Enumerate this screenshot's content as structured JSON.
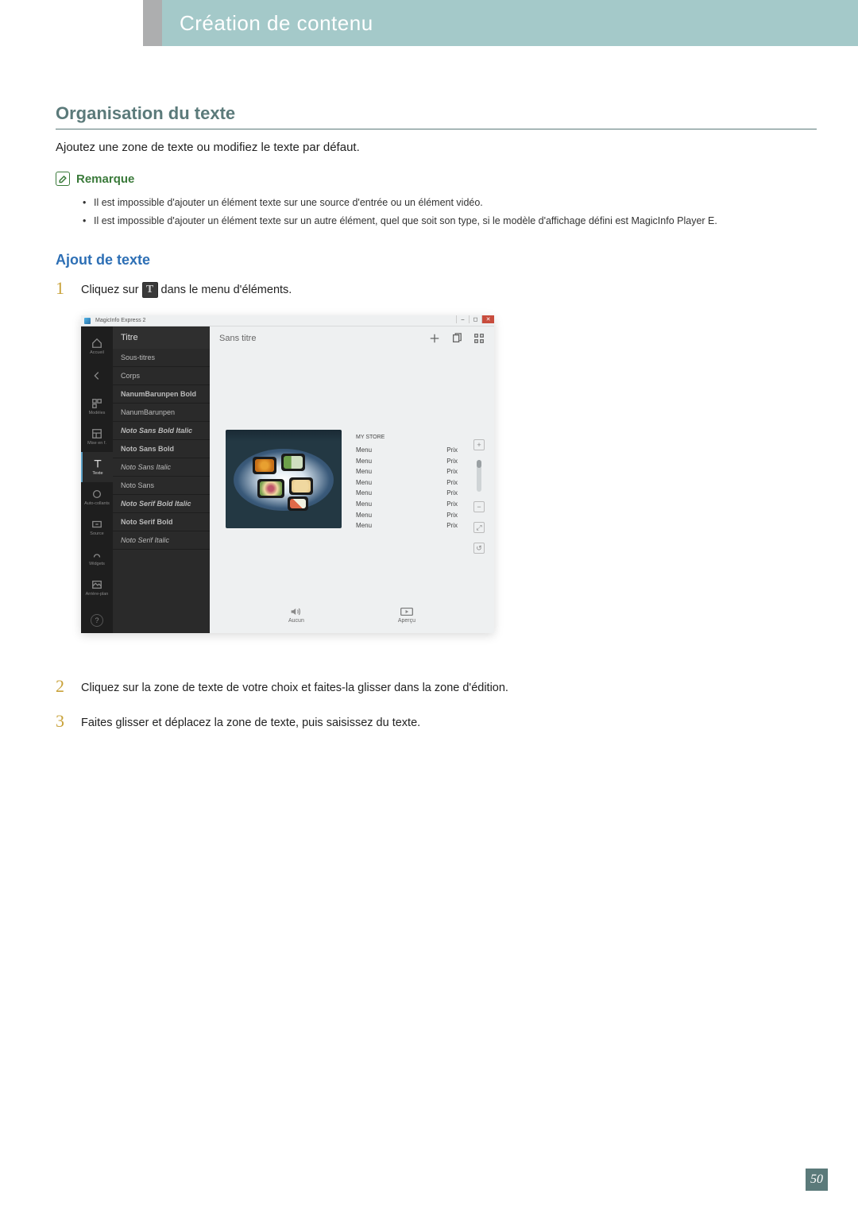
{
  "header": {
    "title": "Création de contenu"
  },
  "section": {
    "heading": "Organisation du texte",
    "intro": "Ajoutez une zone de texte ou modifiez le texte par défaut.",
    "note_label": "Remarque",
    "notes": [
      "Il est impossible d'ajouter un élément texte sur une source d'entrée ou un élément vidéo.",
      "Il est impossible d'ajouter un élément texte sur un autre élément, quel que soit son type, si le modèle d'affichage défini est MagicInfo Player E."
    ],
    "sub_heading": "Ajout de texte",
    "steps": [
      {
        "num": "1",
        "before": "Cliquez sur",
        "after": "dans le menu d'éléments."
      },
      {
        "num": "2",
        "text": "Cliquez sur la zone de texte de votre choix et faites-la glisser dans la zone d'édition."
      },
      {
        "num": "3",
        "text": "Faites glisser et déplacez la zone de texte, puis saisissez du texte."
      }
    ],
    "inline_icon_label": "T"
  },
  "shot": {
    "app_name": "MagicInfo Express 2",
    "doc_title": "Sans titre",
    "rail": [
      {
        "label": "Accueil",
        "icon": "home"
      },
      {
        "label": "",
        "icon": "back"
      },
      {
        "label": "Modèles",
        "icon": "templates"
      },
      {
        "label": "Mise en f.",
        "icon": "layout"
      },
      {
        "label": "Texte",
        "icon": "text",
        "selected": true
      },
      {
        "label": "Auto-collants",
        "icon": "sticker"
      },
      {
        "label": "Source",
        "icon": "source"
      },
      {
        "label": "Widgets",
        "icon": "widget"
      },
      {
        "label": "Arrière-plan",
        "icon": "bg"
      }
    ],
    "font_head": "Titre",
    "fonts": [
      {
        "label": "Sous-titres",
        "class": ""
      },
      {
        "label": "Corps",
        "class": ""
      },
      {
        "label": "NanumBarunpen Bold",
        "class": "bold"
      },
      {
        "label": "NanumBarunpen",
        "class": ""
      },
      {
        "label": "Noto Sans Bold Italic",
        "class": "bold italic"
      },
      {
        "label": "Noto Sans Bold",
        "class": "bold"
      },
      {
        "label": "Noto Sans Italic",
        "class": "italic"
      },
      {
        "label": "Noto Sans",
        "class": ""
      },
      {
        "label": "Noto Serif Bold Italic",
        "class": "bold italic"
      },
      {
        "label": "Noto Serif Bold",
        "class": "bold"
      },
      {
        "label": "Noto Serif Italic",
        "class": "italic"
      }
    ],
    "price_header": "MY STORE",
    "menu_label": "Menu",
    "price_label": "Prix",
    "row_count": 8,
    "bottom": {
      "left": "Aucun",
      "right": "Aperçu"
    }
  },
  "page_number": "50"
}
